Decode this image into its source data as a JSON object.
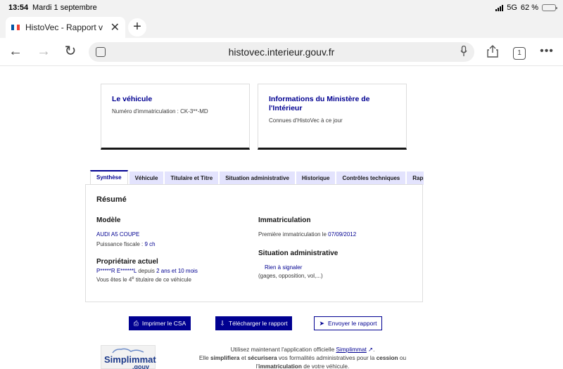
{
  "status_bar": {
    "time": "13:54",
    "date": "Mardi 1 septembre",
    "network": "5G",
    "battery": "62 %",
    "battery_level": 0.62
  },
  "browser": {
    "tab_title": "HistoVec - Rapport vendeur",
    "url": "histovec.interieur.gouv.fr",
    "tab_count": "1",
    "icons": {
      "close": "close-icon",
      "new_tab": "plus-icon",
      "back": "back-arrow-icon",
      "forward": "forward-arrow-icon",
      "reload": "reload-icon",
      "share": "share-icon",
      "more": "more-icon",
      "mic": "microphone-icon"
    }
  },
  "cards": [
    {
      "title": "Le véhicule",
      "subtitle": "Numéro d'immatriculation : CK-3**-MD"
    },
    {
      "title": "Informations du Ministère de l'Intérieur",
      "subtitle": "Connues d'HistoVec à ce jour"
    }
  ],
  "tabs": [
    "Synthèse",
    "Véhicule",
    "Titulaire et Titre",
    "Situation administrative",
    "Historique",
    "Contrôles techniques",
    "Rapport"
  ],
  "summary": {
    "heading": "Résumé",
    "modele": {
      "label": "Modèle",
      "model": "AUDI A5 COUPE",
      "power_label": "Puissance fiscale : ",
      "power": "9 ch"
    },
    "proprietaire": {
      "label": "Propriétaire actuel",
      "name": "P*****R E******L",
      "since_prefix": "depuis",
      "since": "2 ans et 10 mois",
      "rank_prefix": "Vous êtes le ",
      "rank_number": "4",
      "rank_sup": "e",
      "rank_suffix": " titulaire de ce véhicule"
    },
    "immatriculation": {
      "label": "Immatriculation",
      "first_label": "Première immatriculation le ",
      "first_date": "07/09/2012"
    },
    "situation": {
      "label": "Situation administrative",
      "status": "Rien à signaler",
      "details": "(gages, opposition, vol,...)"
    }
  },
  "buttons": [
    {
      "label": "Imprimer le CSA",
      "icon": "print-icon"
    },
    {
      "label": "Télécharger le rapport",
      "icon": "download-icon"
    },
    {
      "label": "Envoyer le rapport",
      "icon": "send-icon"
    }
  ],
  "promo": {
    "logo_text": "Simplimmat",
    "logo_suffix": ".gouv",
    "line1_prefix": "Utilisez maintenant l'application officielle ",
    "line1_link": "Simplimmat",
    "line1_suffix": ".",
    "line2_a": "Elle ",
    "line2_b": "simplifiera",
    "line2_c": " et ",
    "line2_d": "sécurisera",
    "line2_e": " vos formalités administratives pour la ",
    "line2_f": "cession",
    "line2_g": " ou",
    "line3_a": "l'",
    "line3_b": "immatriculation",
    "line3_c": " de votre véhicule."
  },
  "colors": {
    "accent": "#000091",
    "tab_bg": "#e3e3fd"
  }
}
